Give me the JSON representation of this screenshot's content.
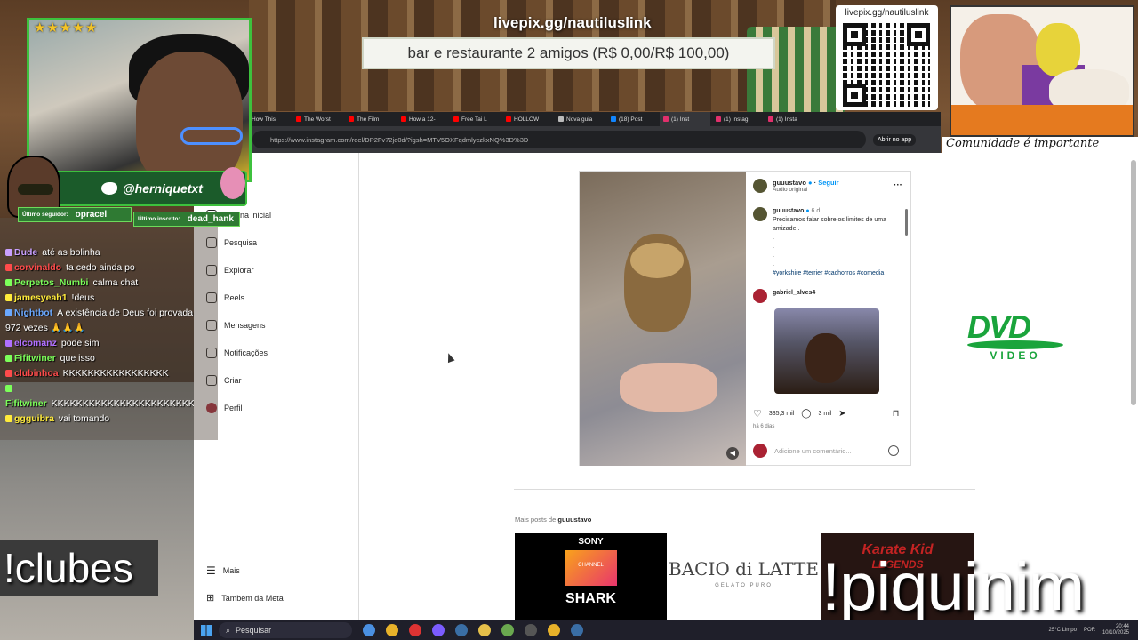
{
  "overlay": {
    "livepix_header": "livepix.gg/nautiluslink",
    "goal_text": "bar e restaurante 2 amigos (R$ 0,00/R$ 100,00)",
    "qr_label": "livepix.gg/nautiluslink",
    "community_text": "Comunidade é importante",
    "twitter_handle": "@herniquetxt",
    "last_follower_label": "Último seguidor:",
    "last_follower": "opracel",
    "last_sub_label": "Último inscrito:",
    "last_sub": "dead_hank",
    "stars": "★★★★★",
    "clubes_cmd": "!clubes",
    "piquinim_cmd": "!piquinim",
    "dvd_logo": "DVD",
    "dvd_video": "VIDEO"
  },
  "browser": {
    "tabs": [
      {
        "label": "How This"
      },
      {
        "label": "The Worst"
      },
      {
        "label": "The Film"
      },
      {
        "label": "How a 12-"
      },
      {
        "label": "Free Tai L"
      },
      {
        "label": "HOLLOW"
      },
      {
        "label": "Nova guia"
      },
      {
        "label": "(18) Post"
      },
      {
        "label": "(1) Inst"
      },
      {
        "label": "(1) Instag"
      },
      {
        "label": "(1) Insta"
      }
    ],
    "url": "https://www.instagram.com/reel/DP2Fv72je0d/?igsh=MTV5OXFqdmlyczkxNQ%3D%3D",
    "open_app": "Abrir no app"
  },
  "instagram": {
    "nav": [
      {
        "label": "Página inicial",
        "icon": "home-icon"
      },
      {
        "label": "Pesquisa",
        "icon": "search-icon"
      },
      {
        "label": "Explorar",
        "icon": "compass-icon"
      },
      {
        "label": "Reels",
        "icon": "reels-icon"
      },
      {
        "label": "Mensagens",
        "icon": "messenger-icon"
      },
      {
        "label": "Notificações",
        "icon": "heart-icon"
      },
      {
        "label": "Criar",
        "icon": "plus-icon"
      },
      {
        "label": "Perfil",
        "icon": "avatar"
      }
    ],
    "nav_more": "Mais",
    "nav_meta": "Também da Meta",
    "post": {
      "username": "guuustavo",
      "follow": "Seguir",
      "audio": "Áudio original",
      "caption_user": "guuustavo",
      "caption_time": "6 d",
      "caption": "Precisamos falar sobre os limites de uma amizade..",
      "dots": [
        ".",
        ".",
        ".",
        "."
      ],
      "hashtags": "#yorkshire #terrier #cachorros #comedia",
      "comment_user": "gabriel_alves4",
      "likes": "335,3 mil",
      "comments_count": "3 mil",
      "time_ago": "há 6 dias",
      "add_comment": "Adicione um comentário..."
    },
    "more_posts_prefix": "Mais posts de ",
    "more_posts_user": "guuustavo",
    "thumbs": [
      {
        "top": "SONY",
        "mid": "CHANNEL",
        "bottom": "SHARK"
      },
      {
        "top": "BACIO di LATTE",
        "bottom": "GELATO PURO"
      },
      {
        "top": "Karate Kid",
        "bottom": "LEGENDS"
      }
    ]
  },
  "chat": [
    {
      "nick": "Dude",
      "color": "#c9a0ff",
      "msg": "até as bolinha"
    },
    {
      "nick": "corvinaldo",
      "color": "#ff4b4b",
      "msg": "ta cedo ainda po"
    },
    {
      "nick": "Perpetos_Numbi",
      "color": "#7cff5a",
      "msg": "calma chat"
    },
    {
      "nick": "jamesyeah1",
      "color": "#ffeb3b",
      "msg": "!deus"
    },
    {
      "nick": "Nightbot",
      "color": "#6aa8ff",
      "msg": "A existência de Deus foi provada 972 vezes 🙏🙏🙏"
    },
    {
      "nick": "elcomanz",
      "color": "#b070ff",
      "msg": "pode sim"
    },
    {
      "nick": "Fifitwiner",
      "color": "#7cff5a",
      "msg": "que isso"
    },
    {
      "nick": "clubinhoa",
      "color": "#ff4b4b",
      "msg": "KKKKKKKKKKKKKKKKK"
    },
    {
      "nick": "Fifitwiner",
      "color": "#7cff5a",
      "msg": "KKKKKKKKKKKKKKKKKKKKKKKKKKK"
    },
    {
      "nick": "ggguibra",
      "color": "#ffeb3b",
      "msg": "vai tomando"
    }
  ],
  "taskbar": {
    "search": "Pesquisar",
    "weather": "25°C Limpo",
    "lang": "POR",
    "time": "20:44",
    "date": "10/10/2025"
  }
}
